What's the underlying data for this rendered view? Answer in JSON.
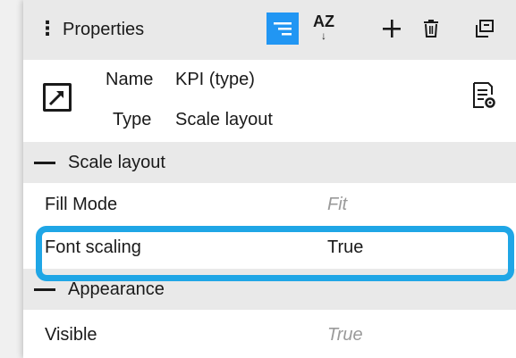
{
  "panel": {
    "title": "Properties",
    "toolbar": {
      "categorized_icon": "categorized-view-icon",
      "sort_az_label": "AZ",
      "add_icon": "plus-icon",
      "delete_icon": "trash-icon",
      "popout_icon": "popout-window-icon"
    }
  },
  "object": {
    "name_label": "Name",
    "name_value": "KPI (type)",
    "type_label": "Type",
    "type_value": "Scale layout",
    "icon": "scale-layout-icon",
    "doc_icon": "document-settings-icon"
  },
  "sections": [
    {
      "title": "Scale layout",
      "properties": [
        {
          "name": "Fill Mode",
          "value": "Fit",
          "is_default": true
        },
        {
          "name": "Font scaling",
          "value": "True",
          "is_default": false
        }
      ]
    },
    {
      "title": "Appearance",
      "properties": [
        {
          "name": "Visible",
          "value": "True",
          "is_default": true
        }
      ]
    }
  ],
  "highlight_color": "#1fa6e6",
  "accent_color": "#2196f3"
}
